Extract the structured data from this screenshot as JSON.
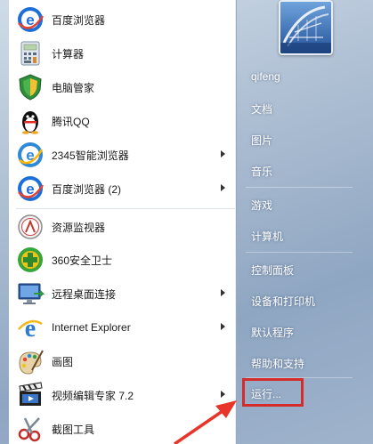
{
  "left_items": [
    {
      "label": "百度浏览器",
      "icon": "baidu-browser-icon",
      "submenu": false
    },
    {
      "label": "计算器",
      "icon": "calculator-icon",
      "submenu": false
    },
    {
      "label": "电脑管家",
      "icon": "pc-manager-shield-icon",
      "submenu": false
    },
    {
      "label": "腾讯QQ",
      "icon": "qq-penguin-icon",
      "submenu": false
    },
    {
      "label": "2345智能浏览器",
      "icon": "2345-browser-icon",
      "submenu": true
    },
    {
      "label": "百度浏览器 (2)",
      "icon": "baidu-browser-icon",
      "submenu": true
    },
    {
      "label": "资源监视器",
      "icon": "resource-monitor-icon",
      "submenu": false
    },
    {
      "label": "360安全卫士",
      "icon": "360-security-icon",
      "submenu": false
    },
    {
      "label": "远程桌面连接",
      "icon": "remote-desktop-icon",
      "submenu": true
    },
    {
      "label": "Internet Explorer",
      "icon": "internet-explorer-icon",
      "submenu": true
    },
    {
      "label": "画图",
      "icon": "paint-icon",
      "submenu": false
    },
    {
      "label": "视频编辑专家 7.2",
      "icon": "video-editor-icon",
      "submenu": true
    },
    {
      "label": "截图工具",
      "icon": "snipping-tool-icon",
      "submenu": false
    }
  ],
  "right_items": [
    {
      "label": "qifeng"
    },
    {
      "label": "文档"
    },
    {
      "label": "图片"
    },
    {
      "label": "音乐"
    },
    {
      "label": "游戏"
    },
    {
      "label": "计算机"
    },
    {
      "label": "控制面板"
    },
    {
      "label": "设备和打印机"
    },
    {
      "label": "默认程序"
    },
    {
      "label": "帮助和支持"
    },
    {
      "label": "运行..."
    }
  ],
  "highlight_color": "#d62b2b"
}
